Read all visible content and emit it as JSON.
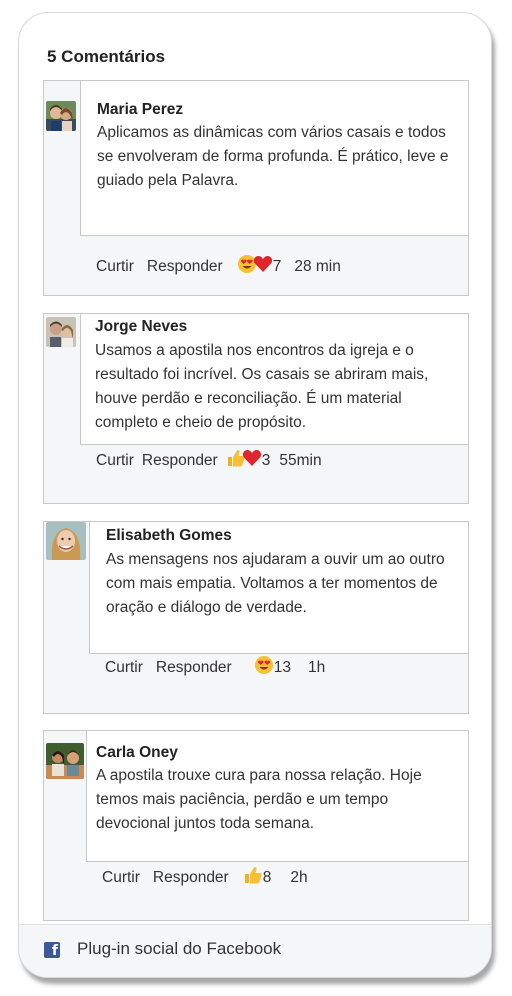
{
  "header": {
    "count_title": "5 Comentários"
  },
  "comments": [
    {
      "author": "Maria Perez",
      "text": "Aplicamos as dinâmicas com vários casais e todos se envolveram de forma profunda. É prático, leve e guiado pela Palavra.",
      "like_label": "Curtir",
      "reply_label": "Responder",
      "reactions": [
        "heart-eyes-emoji",
        "heart-emoji"
      ],
      "reaction_count": "7",
      "time": "28 min"
    },
    {
      "author": "Jorge Neves",
      "text": "Usamos a apostila nos encontros da igreja e o resultado foi incrível. Os casais se abriram mais, houve perdão e reconciliação. É um material completo e cheio de propósito.",
      "like_label": "Curtir",
      "reply_label": "Responder",
      "reactions": [
        "thumbs-up-emoji",
        "heart-emoji"
      ],
      "reaction_count": "3",
      "time": "55min"
    },
    {
      "author": "Elisabeth Gomes",
      "text": "As mensagens nos ajudaram a ouvir um ao outro com mais empatia. Voltamos a ter momentos de oração e diálogo de verdade.",
      "like_label": "Curtir",
      "reply_label": "Responder",
      "reactions": [
        "heart-eyes-emoji"
      ],
      "reaction_count": "13",
      "time": "1h"
    },
    {
      "author": "Carla Oney",
      "text": "A apostila trouxe cura para nossa relação. Hoje temos mais paciência, perdão e um tempo devocional juntos toda semana.",
      "like_label": "Curtir",
      "reply_label": "Responder",
      "reactions": [
        "thumbs-up-emoji"
      ],
      "reaction_count": "8",
      "time": "2h"
    }
  ],
  "footer": {
    "label": "Plug-in social do Facebook",
    "icon": "facebook-icon"
  },
  "colors": {
    "facebook_blue": "#3b5998",
    "panel_bg": "#f5f6f7",
    "border": "#c8c8c8"
  }
}
